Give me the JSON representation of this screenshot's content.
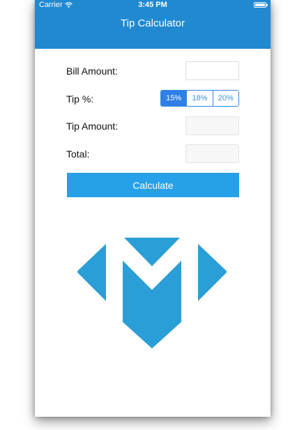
{
  "status_bar": {
    "carrier": "Carrier",
    "time": "3:45 PM"
  },
  "nav": {
    "title": "Tip Calculator"
  },
  "form": {
    "bill_label": "Bill Amount:",
    "bill_value": "",
    "tip_label": "Tip %:",
    "tip_options": [
      "15%",
      "18%",
      "20%"
    ],
    "tip_selected": "15%",
    "tip_amount_label": "Tip Amount:",
    "tip_amount_value": "",
    "total_label": "Total:",
    "total_value": ""
  },
  "calculate_button": {
    "label": "Calculate"
  },
  "colors": {
    "nav_background": "#2189d0",
    "button_background": "#26a0e8",
    "segment_selected": "#2e7fe6",
    "logo": "#2a9ed6"
  },
  "logo": {
    "icon": "m-chevron-logo-icon"
  }
}
